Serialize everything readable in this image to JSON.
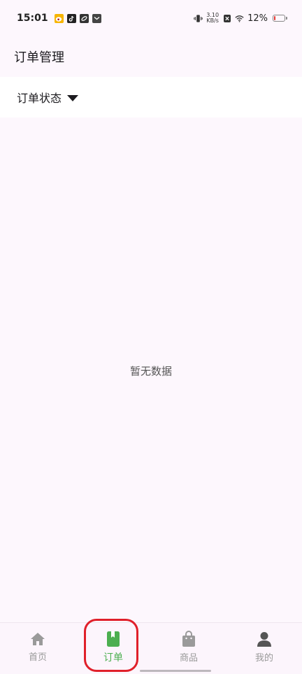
{
  "status_bar": {
    "time": "15:01",
    "net_speed_value": "3.10",
    "net_speed_unit": "KB/s",
    "battery_percent": "12%",
    "battery_level": 0.12,
    "icons": [
      "weibo-icon",
      "tiktok-icon",
      "link-app-icon",
      "mail-app-icon",
      "vibrate-icon",
      "no-sim-icon",
      "wifi-icon",
      "battery-icon"
    ]
  },
  "header": {
    "title": "订单管理"
  },
  "filter": {
    "label": "订单状态"
  },
  "main": {
    "empty_text": "暂无数据"
  },
  "bottom_nav": {
    "items": [
      {
        "label": "首页",
        "icon": "home-icon"
      },
      {
        "label": "订单",
        "icon": "bookmark-book-icon",
        "active": true
      },
      {
        "label": "商品",
        "icon": "shopping-bag-icon"
      },
      {
        "label": "我的",
        "icon": "person-icon"
      }
    ]
  },
  "colors": {
    "background": "#fdf7fd",
    "active": "#4caf50",
    "inactive": "#999999",
    "highlight": "#e0202a",
    "battery_low": "#e53935"
  }
}
